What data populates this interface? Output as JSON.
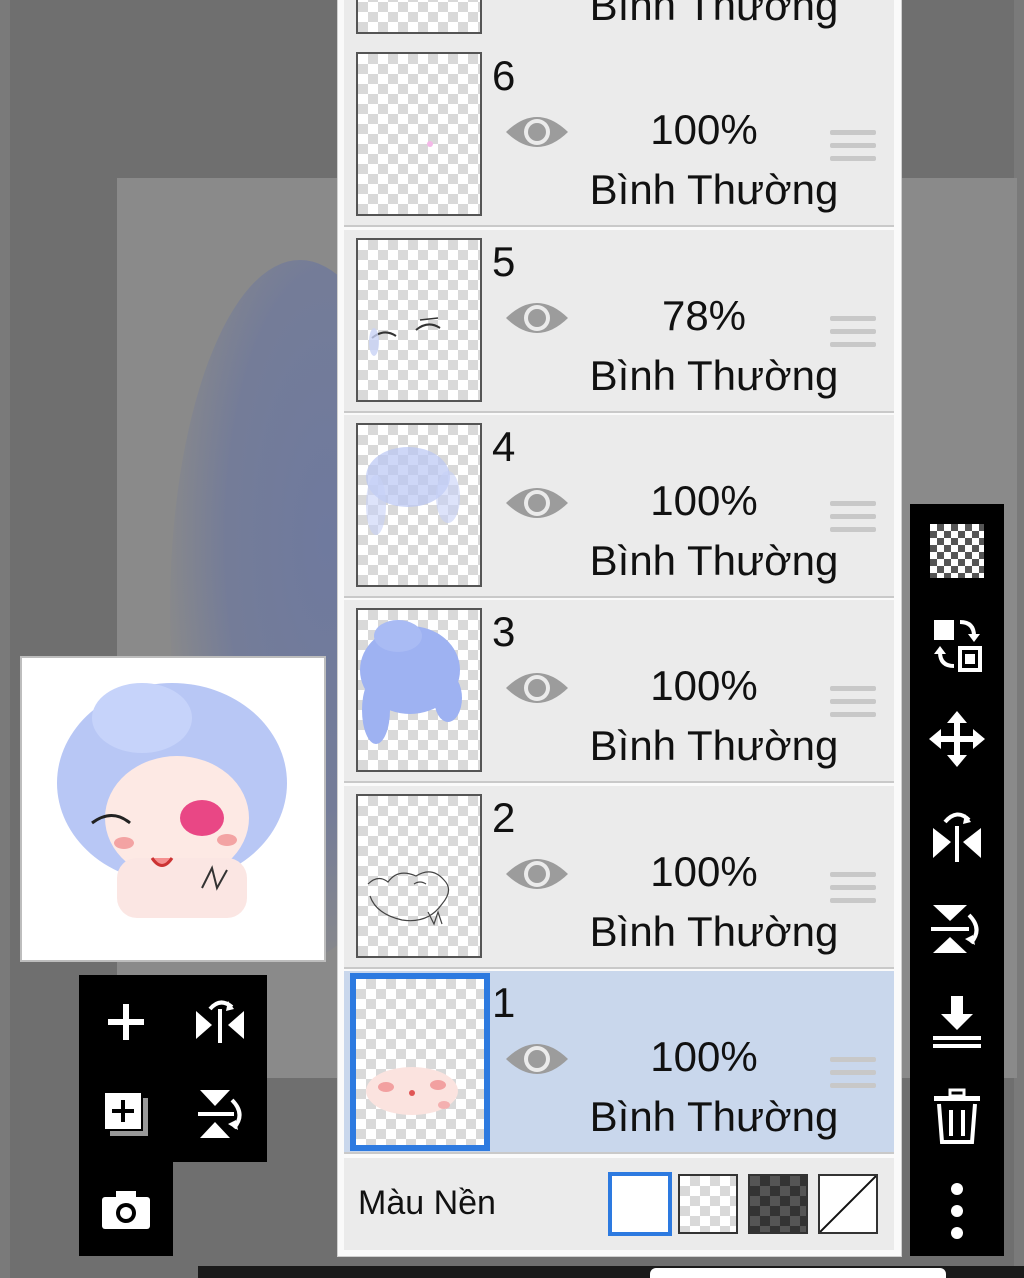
{
  "layers_panel": {
    "partial_top_layer": {
      "blend": "Bình Thường"
    },
    "layers": [
      {
        "number": "6",
        "opacity": "100%",
        "blend": "Bình Thường",
        "visible": true,
        "selected": false
      },
      {
        "number": "5",
        "opacity": "78%",
        "blend": "Bình Thường",
        "visible": true,
        "selected": false
      },
      {
        "number": "4",
        "opacity": "100%",
        "blend": "Bình Thường",
        "visible": true,
        "selected": false
      },
      {
        "number": "3",
        "opacity": "100%",
        "blend": "Bình Thường",
        "visible": true,
        "selected": false
      },
      {
        "number": "2",
        "opacity": "100%",
        "blend": "Bình Thường",
        "visible": true,
        "selected": false
      },
      {
        "number": "1",
        "opacity": "100%",
        "blend": "Bình Thường",
        "visible": true,
        "selected": true
      }
    ],
    "background_row": {
      "label": "Màu Nền",
      "options": [
        "white",
        "transparent-light",
        "transparent-dark",
        "none"
      ],
      "selected": "white"
    }
  },
  "left_toolbar": {
    "buttons": [
      "add-layer-icon",
      "flip-horizontal-icon",
      "duplicate-layer-icon",
      "flip-vertical-icon",
      "camera-icon"
    ]
  },
  "right_toolbar": {
    "buttons": [
      "transparency-checker-icon",
      "swap-layers-icon",
      "move-icon",
      "flip-horizontal-icon",
      "flip-vertical-icon",
      "merge-down-icon",
      "trash-icon",
      "more-vertical-icon"
    ]
  },
  "colors": {
    "selected_layer_bg": "#c9d7ec",
    "selection_accent": "#2d7ae0",
    "toolbar_bg": "#000000",
    "panel_row_bg": "#ebebeb"
  }
}
